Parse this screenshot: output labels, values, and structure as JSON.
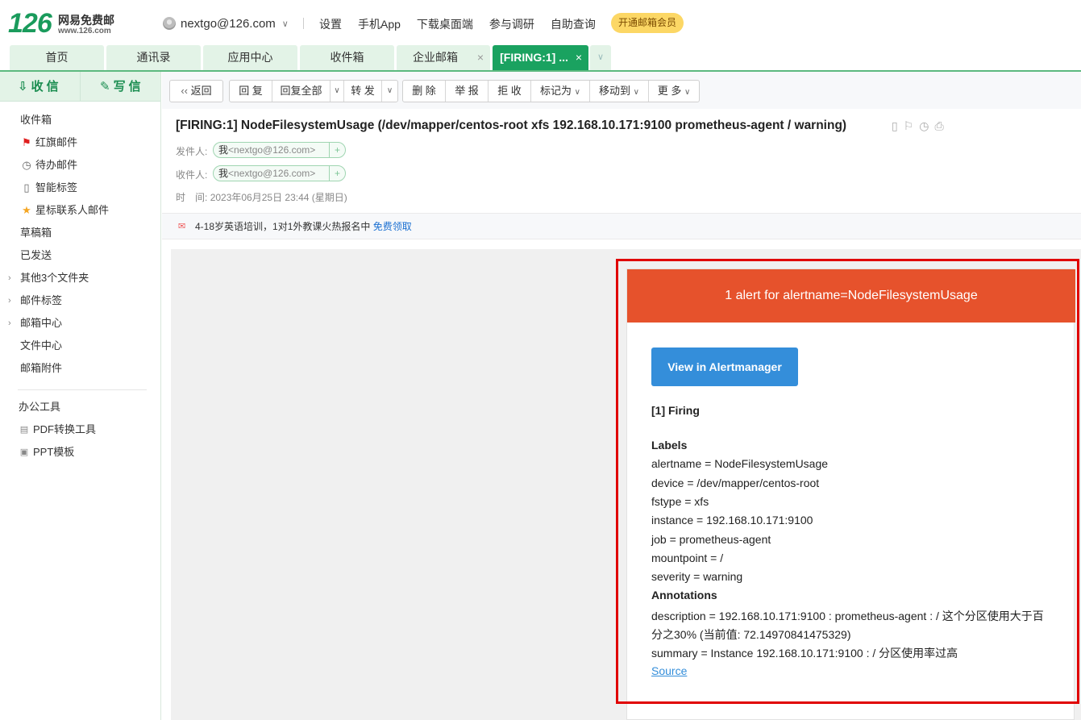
{
  "brand": {
    "logo_num": "126",
    "logo_name": "网易免费邮",
    "logo_url": "www.126.com"
  },
  "account": {
    "email": "nextgo@126.com"
  },
  "top_links": [
    "设置",
    "手机App",
    "下载桌面端",
    "参与调研",
    "自助查询"
  ],
  "vip_button": "开通邮箱会员",
  "tabs": [
    {
      "label": "首页"
    },
    {
      "label": "通讯录"
    },
    {
      "label": "应用中心"
    },
    {
      "label": "收件箱"
    },
    {
      "label": "企业邮箱"
    },
    {
      "label": "[FIRING:1] ..."
    }
  ],
  "sidebar": {
    "receive": "收信",
    "compose": "写信",
    "items": [
      {
        "label": "收件箱"
      },
      {
        "label": "红旗邮件",
        "icon": "flag-icon"
      },
      {
        "label": "待办邮件",
        "icon": "clock-icon"
      },
      {
        "label": "智能标签",
        "icon": "bookmark-icon"
      },
      {
        "label": "星标联系人邮件",
        "icon": "star-icon"
      },
      {
        "label": "草稿箱"
      },
      {
        "label": "已发送"
      },
      {
        "label": "其他3个文件夹"
      },
      {
        "label": "邮件标签"
      },
      {
        "label": "邮箱中心"
      },
      {
        "label": "文件中心"
      },
      {
        "label": "邮箱附件"
      },
      {
        "label": "办公工具"
      },
      {
        "label": "PDF转换工具",
        "icon": "pdf-icon"
      },
      {
        "label": "PPT模板",
        "icon": "ppt-icon"
      }
    ]
  },
  "toolbar": {
    "back": "返回",
    "reply": "回 复",
    "reply_all": "回复全部",
    "forward": "转 发",
    "delete": "删 除",
    "report": "举 报",
    "reject": "拒 收",
    "mark_as": "标记为",
    "move_to": "移动到",
    "more": "更 多"
  },
  "message": {
    "subject": "[FIRING:1] NodeFilesystemUsage (/dev/mapper/centos-root xfs 192.168.10.171:9100 prometheus-agent / warning)",
    "from_label": "发件人:",
    "from_name": "我",
    "from_email": "<nextgo@126.com>",
    "to_label": "收件人:",
    "to_name": "我",
    "to_email": "<nextgo@126.com>",
    "time_label": "时　间:",
    "time_value": "2023年06月25日 23:44 (星期日)"
  },
  "ad": {
    "text": "4-18岁英语培训，1对1外教课火热报名中",
    "link": "免费领取"
  },
  "alert": {
    "header": "1 alert for alertname=NodeFilesystemUsage",
    "button": "View in Alertmanager",
    "firing": "[1] Firing",
    "labels_title": "Labels",
    "labels": [
      "alertname = NodeFilesystemUsage",
      "device = /dev/mapper/centos-root",
      "fstype = xfs",
      "instance = 192.168.10.171:9100",
      "job = prometheus-agent",
      "mountpoint = /",
      "severity = warning"
    ],
    "annotations_title": "Annotations",
    "description_1": "description = 192.168.10.171:9100 : prometheus-agent : / 这个分区使用大于百",
    "description_2": "分之30% (当前值: 72.14970841475329)",
    "summary": "summary = Instance 192.168.10.171:9100 : / 分区使用率过高",
    "source": "Source"
  }
}
